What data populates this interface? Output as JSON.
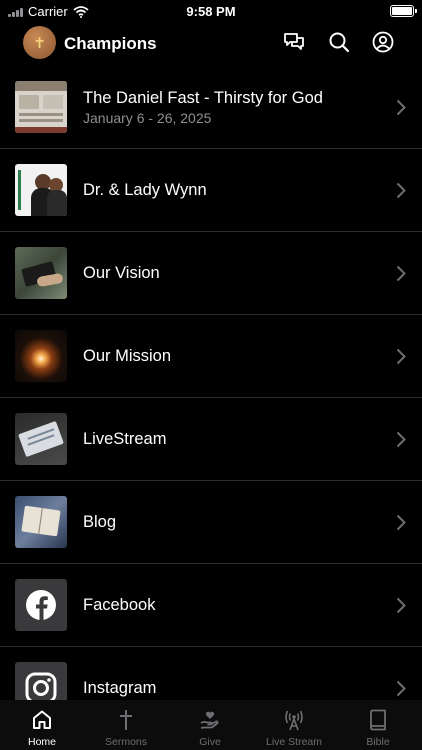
{
  "status_bar": {
    "carrier": "Carrier",
    "time": "9:58 PM"
  },
  "header": {
    "title": "Champions"
  },
  "list": {
    "items": [
      {
        "title": "The Daniel Fast - Thirsty for God",
        "subtitle": "January 6 - 26, 2025"
      },
      {
        "title": "Dr. & Lady Wynn"
      },
      {
        "title": "Our Vision"
      },
      {
        "title": "Our Mission"
      },
      {
        "title": "LiveStream"
      },
      {
        "title": "Blog"
      },
      {
        "title": "Facebook"
      },
      {
        "title": "Instagram"
      }
    ]
  },
  "tabbar": {
    "tabs": [
      {
        "label": "Home",
        "icon": "home-icon",
        "active": true
      },
      {
        "label": "Sermons",
        "icon": "cross-icon"
      },
      {
        "label": "Give",
        "icon": "give-hand-icon"
      },
      {
        "label": "Live Stream",
        "icon": "broadcast-icon"
      },
      {
        "label": "Bible",
        "icon": "book-icon"
      }
    ]
  },
  "colors": {
    "background": "#000000",
    "divider": "#2c2c2e",
    "secondary_text": "#8e8e93",
    "inactive_tab": "#6e6e73"
  }
}
